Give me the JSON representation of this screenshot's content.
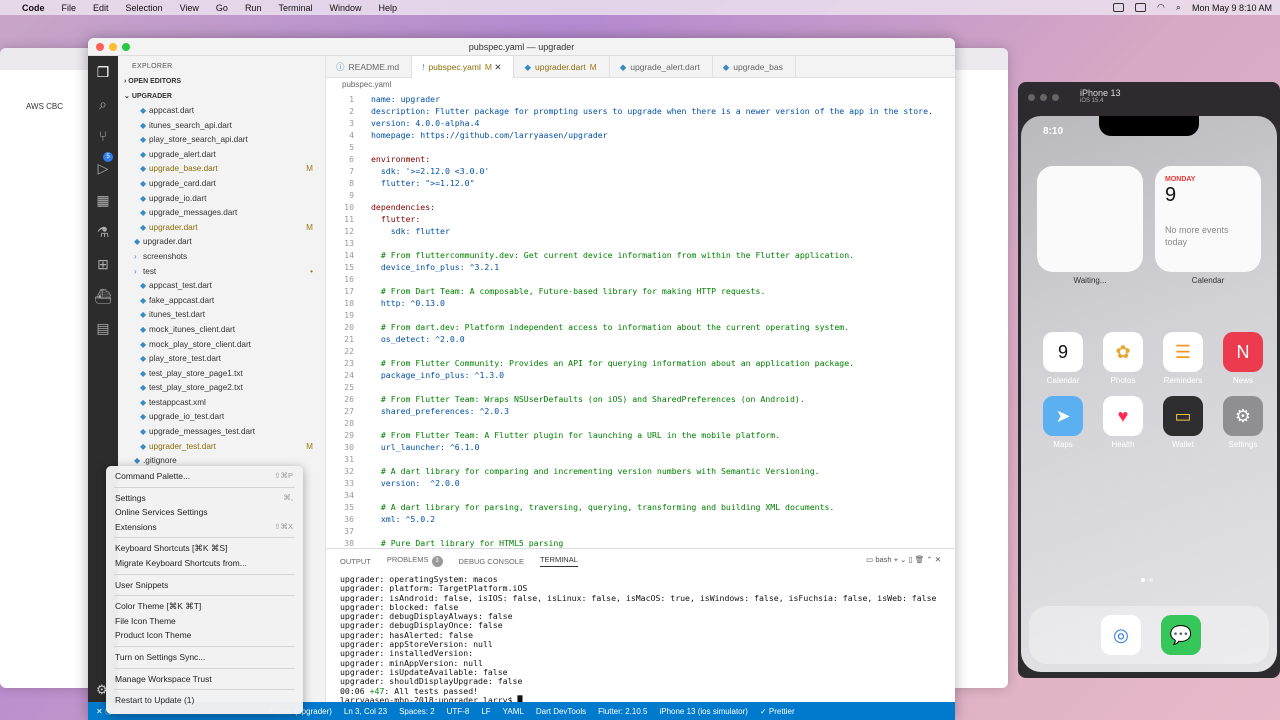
{
  "menubar": {
    "app": "Code",
    "items": [
      "File",
      "Edit",
      "Selection",
      "View",
      "Go",
      "Run",
      "Terminal",
      "Window",
      "Help"
    ],
    "clock": "Mon May 9  8:10 AM"
  },
  "browser": {
    "bookmarks": "AWS    CBC"
  },
  "simulator": {
    "device": "iPhone 13",
    "os": "iOS 15.4",
    "time": "8:10",
    "widget_left_label": "Waiting...",
    "cal_month": "MONDAY",
    "cal_day": "9",
    "cal_events": "No more events today",
    "widget_right_label": "Calendar",
    "apps": [
      {
        "name": "Calendar",
        "glyph": "9"
      },
      {
        "name": "Photos",
        "glyph": "✿"
      },
      {
        "name": "Reminders",
        "glyph": "☰"
      },
      {
        "name": "News",
        "glyph": "N"
      },
      {
        "name": "Maps",
        "glyph": "➤"
      },
      {
        "name": "Health",
        "glyph": "♥"
      },
      {
        "name": "Wallet",
        "glyph": "▭"
      },
      {
        "name": "Settings",
        "glyph": "⚙"
      }
    ],
    "dock": [
      {
        "name": "Safari",
        "glyph": "◎"
      },
      {
        "name": "Messages",
        "glyph": "💬"
      }
    ],
    "calendar_icon_mon": "MON"
  },
  "vscode": {
    "window_title": "pubspec.yaml — upgrader",
    "explorer_title": "EXPLORER",
    "open_editors": "OPEN EDITORS",
    "project": "UPGRADER",
    "files": [
      {
        "name": "appcast.dart",
        "mod": ""
      },
      {
        "name": "itunes_search_api.dart",
        "mod": ""
      },
      {
        "name": "play_store_search_api.dart",
        "mod": ""
      },
      {
        "name": "upgrade_alert.dart",
        "mod": ""
      },
      {
        "name": "upgrade_base.dart",
        "mod": "M"
      },
      {
        "name": "upgrade_card.dart",
        "mod": ""
      },
      {
        "name": "upgrade_io.dart",
        "mod": ""
      },
      {
        "name": "upgrade_messages.dart",
        "mod": ""
      },
      {
        "name": "upgrader.dart",
        "mod": "M"
      },
      {
        "name": "upgrader.dart",
        "mod": ""
      },
      {
        "name": "screenshots",
        "mod": ""
      },
      {
        "name": "test",
        "mod": "•"
      },
      {
        "name": "appcast_test.dart",
        "mod": ""
      },
      {
        "name": "fake_appcast.dart",
        "mod": ""
      },
      {
        "name": "itunes_test.dart",
        "mod": ""
      },
      {
        "name": "mock_itunes_client.dart",
        "mod": ""
      },
      {
        "name": "mock_play_store_client.dart",
        "mod": ""
      },
      {
        "name": "play_store_test.dart",
        "mod": ""
      },
      {
        "name": "test_play_store_page1.txt",
        "mod": ""
      },
      {
        "name": "test_play_store_page2.txt",
        "mod": ""
      },
      {
        "name": "testappcast.xml",
        "mod": ""
      },
      {
        "name": "upgrade_io_test.dart",
        "mod": ""
      },
      {
        "name": "upgrade_messages_test.dart",
        "mod": ""
      },
      {
        "name": "upgrader_test.dart",
        "mod": "M"
      },
      {
        "name": ".gitignore",
        "mod": ""
      }
    ],
    "tabs": [
      {
        "name": "README.md",
        "mod": ""
      },
      {
        "name": "pubspec.yaml",
        "mod": "M"
      },
      {
        "name": "upgrader.dart",
        "mod": "M"
      },
      {
        "name": "upgrade_alert.dart",
        "mod": ""
      },
      {
        "name": "upgrade_bas",
        "mod": ""
      }
    ],
    "breadcrumb": "pubspec.yaml",
    "code": [
      "name: upgrader",
      "description: Flutter package for prompting users to upgrade when there is a newer version of the app in the store.",
      "version: 4.0.0-alpha.4",
      "homepage: https://github.com/larryaasen/upgrader",
      "",
      "environment:",
      "  sdk: '>=2.12.0 <3.0.0'",
      "  flutter: \">=1.12.0\"",
      "",
      "dependencies:",
      "  flutter:",
      "    sdk: flutter",
      "",
      "  # From fluttercommunity.dev: Get current device information from within the Flutter application.",
      "  device_info_plus: ^3.2.1",
      "",
      "  # From Dart Team: A composable, Future-based library for making HTTP requests.",
      "  http: ^0.13.0",
      "",
      "  # From dart.dev: Platform independent access to information about the current operating system.",
      "  os_detect: ^2.0.0",
      "",
      "  # From Flutter Community: Provides an API for querying information about an application package.",
      "  package_info_plus: ^1.3.0",
      "",
      "  # From Flutter Team: Wraps NSUserDefaults (on iOS) and SharedPreferences (on Android).",
      "  shared_preferences: ^2.0.3",
      "",
      "  # From Flutter Team: A Flutter plugin for launching a URL in the mobile platform.",
      "  url_launcher: ^6.1.0",
      "",
      "  # A dart library for comparing and incrementing version numbers with Semantic Versioning.",
      "  version:  ^2.0.0",
      "",
      "  # A dart library for parsing, traversing, querying, transforming and building XML documents.",
      "  xml: ^5.0.2",
      "",
      "  # Pure Dart library for HTML5 parsing"
    ],
    "panel_tabs": [
      "OUTPUT",
      "PROBLEMS",
      "DEBUG CONSOLE",
      "TERMINAL"
    ],
    "problems_count": "3",
    "shell": "bash",
    "terminal": [
      "upgrader: operatingSystem: macos",
      "upgrader: platform: TargetPlatform.iOS",
      "upgrader: isAndroid: false, isIOS: false, isLinux: false, isMacOS: true, isWindows: false, isFuchsia: false, isWeb: false",
      "upgrader: blocked: false",
      "upgrader: debugDisplayAlways: false",
      "upgrader: debugDisplayOnce: false",
      "upgrader: hasAlerted: false",
      "upgrader: appStoreVersion: null",
      "upgrader: installedVersion:",
      "upgrader: minAppVersion: null",
      "upgrader: isUpdateAvailable: false",
      "upgrader: shouldDisplayUpgrade: false"
    ],
    "test_result_time": "00:06",
    "test_result_count": "+47",
    "test_result_text": ": All tests passed!",
    "prompt": "larryaasen-mbp-2018:upgrader larry$",
    "status": [
      "Flutter (upgrader)",
      "Ln 3, Col 23",
      "Spaces: 2",
      "UTF-8",
      "LF",
      "YAML",
      "Dart DevTools",
      "Flutter: 2.10.5",
      "iPhone 13 (ios simulator)",
      "✓ Prettier"
    ],
    "status_left": "✕ ⓧ 0 ⚠ 2"
  },
  "context_menu": [
    {
      "label": "Command Palette...",
      "shortcut": "⇧⌘P"
    },
    {
      "sep": true
    },
    {
      "label": "Settings",
      "shortcut": "⌘,"
    },
    {
      "label": "Online Services Settings",
      "shortcut": ""
    },
    {
      "label": "Extensions",
      "shortcut": "⇧⌘X"
    },
    {
      "sep": true
    },
    {
      "label": "Keyboard Shortcuts [⌘K ⌘S]",
      "shortcut": ""
    },
    {
      "label": "Migrate Keyboard Shortcuts from...",
      "shortcut": ""
    },
    {
      "sep": true
    },
    {
      "label": "User Snippets",
      "shortcut": ""
    },
    {
      "sep": true
    },
    {
      "label": "Color Theme [⌘K ⌘T]",
      "shortcut": ""
    },
    {
      "label": "File Icon Theme",
      "shortcut": ""
    },
    {
      "label": "Product Icon Theme",
      "shortcut": ""
    },
    {
      "sep": true
    },
    {
      "label": "Turn on Settings Sync...",
      "shortcut": ""
    },
    {
      "sep": true
    },
    {
      "label": "Manage Workspace Trust",
      "shortcut": ""
    },
    {
      "sep": true
    },
    {
      "label": "Restart to Update (1)",
      "shortcut": ""
    }
  ]
}
